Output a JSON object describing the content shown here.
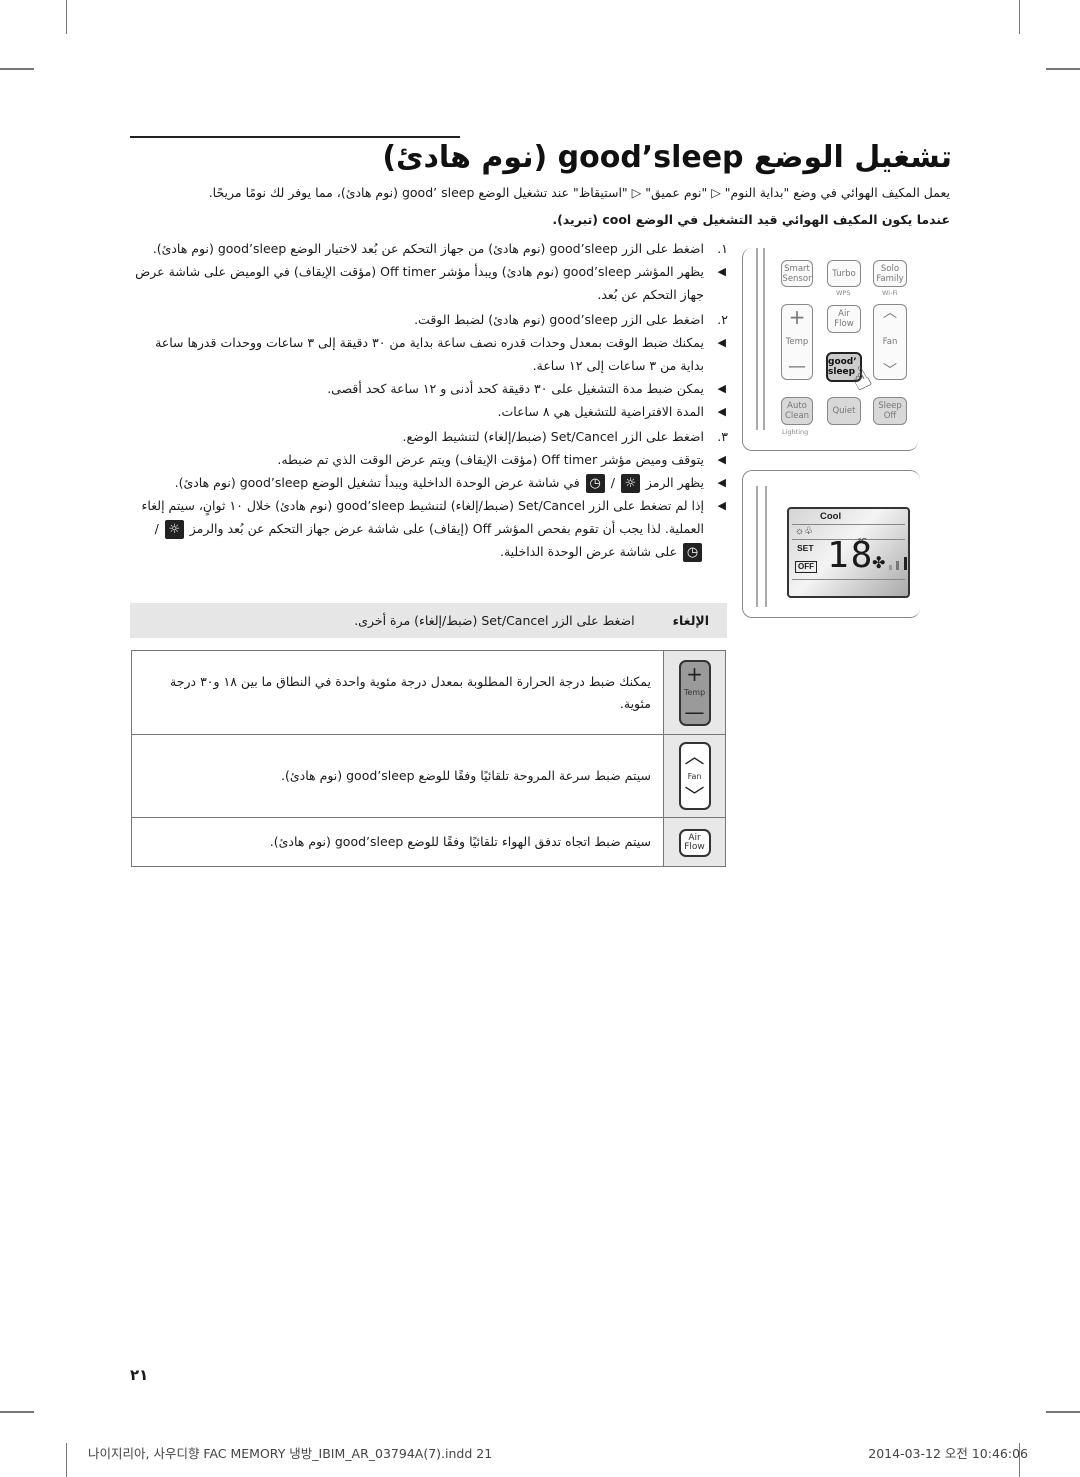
{
  "page": {
    "title": "تشغيل الوضع good’sleep (نوم هادئ)",
    "intro": "يعمل المكيف الهوائي في وضع \"بداية النوم\" ▷ \"نوم عميق\" ▷ \"استيقاظ\" عند تشغيل الوضع good’ sleep (نوم هادئ)، مما يوفر لك نومًا مريحًا.",
    "subheading": "عندما يكون المكيف الهوائي قيد التشغيل في الوضع cool (تبريد).",
    "steps": [
      {
        "num": "١.",
        "text": "اضغط على الزر good’sleep (نوم هادئ) من جهاز التحكم عن بُعد لاختيار الوضع good’sleep (نوم هادئ).",
        "bullets": [
          "يظهر المؤشر good’sleep (نوم هادئ) ويبدأ مؤشر Off timer (مؤقت الإيقاف) في الوميض على شاشة عرض جهاز التحكم عن بُعد."
        ]
      },
      {
        "num": "٢.",
        "text": "اضغط على الزر good’sleep (نوم هادئ) لضبط الوقت.",
        "bullets": [
          "يمكنك ضبط الوقت بمعدل وحدات قدره نصف ساعة بداية من ٣٠ دقيقة إلى ٣ ساعات ووحدات قدرها ساعة بداية من ٣ ساعات إلى ١٢ ساعة.",
          "يمكن ضبط مدة التشغيل على ٣٠ دقيقة كحد أدنى و ١٢ ساعة كحد أقصى.",
          "المدة الافتراضية للتشغيل هي ٨ ساعات."
        ]
      },
      {
        "num": "٣.",
        "text": "اضغط على الزر Set/Cancel (ضبط/إلغاء) لتنشيط الوضع.",
        "bullets": [
          "يتوقف وميض مؤشر Off timer (مؤقت الإيقاف) ويتم عرض الوقت الذي تم ضبطه.",
          "يظهر الرمز [sleep] / [timer] في شاشة عرض الوحدة الداخلية ويبدأ تشغيل الوضع good’sleep (نوم هادئ).",
          "إذا لم تضغط على الزر Set/Cancel (ضبط/إلغاء) لتنشيط good’sleep (نوم هادئ) خلال ١٠ ثوانٍ، سيتم إلغاء العملية. لذا يجب أن تقوم بفحص المؤشر Off (إيقاف) على شاشة عرض جهاز التحكم عن بُعد والرمز [sleep] / [timer] على شاشة عرض الوحدة الداخلية."
        ]
      }
    ],
    "cancel_box": {
      "label": "الإلغاء",
      "text": "اضغط على الزر Set/Cancel (ضبط/إلغاء) مرة أخرى."
    },
    "feature_table": [
      {
        "icon": "temp-button-icon",
        "button_label": "Temp",
        "text": "يمكنك ضبط درجة الحرارة المطلوبة بمعدل درجة مئوية واحدة في النطاق ما بين ١٨ و٣٠ درجة مئوية."
      },
      {
        "icon": "fan-button-icon",
        "button_label": "Fan",
        "text": "سيتم ضبط سرعة المروحة تلقائيًا وفقًا للوضع good’sleep (نوم هادئ)."
      },
      {
        "icon": "airflow-button-icon",
        "button_label": "Air Flow",
        "text": "سيتم ضبط اتجاه تدفق الهواء تلقائيًا وفقًا للوضع good’sleep (نوم هادئ)."
      }
    ],
    "page_number": "٢١"
  },
  "remote": {
    "buttons": {
      "smart_sensor": "Smart Sensor",
      "turbo": "Turbo",
      "wps": "WPS",
      "solo_family": "Solo Family",
      "wifi": "Wi-Fi",
      "temp": "Temp",
      "air_flow": "Air Flow",
      "fan": "Fan",
      "good_sleep": "good’ sleep",
      "auto_clean": "Auto Clean",
      "lighting": "Lighting",
      "quiet": "Quiet",
      "sleep_off": "Sleep Off"
    }
  },
  "indoor_display": {
    "mode": "Cool",
    "set_label": "SET",
    "off_label": "OFF",
    "temperature": "18",
    "unit": "°C"
  },
  "footer": {
    "slug": "나이지리아, 사우디향 FAC MEMORY 냉방_IBIM_AR_03794A(7).indd   21",
    "timestamp": "2014-03-12   오전 10:46:06"
  }
}
